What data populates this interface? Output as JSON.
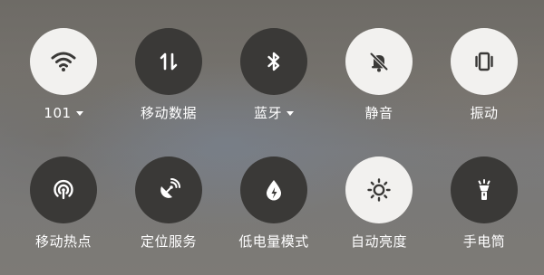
{
  "quick_settings": {
    "row1": [
      {
        "key": "wifi",
        "label": "101",
        "has_dropdown": true,
        "state": "on",
        "icon": "wifi-icon"
      },
      {
        "key": "mobile_data",
        "label": "移动数据",
        "has_dropdown": false,
        "state": "off",
        "icon": "data-transfer-icon"
      },
      {
        "key": "bluetooth",
        "label": "蓝牙",
        "has_dropdown": true,
        "state": "off",
        "icon": "bluetooth-icon"
      },
      {
        "key": "silent",
        "label": "静音",
        "has_dropdown": false,
        "state": "on",
        "icon": "bell-off-icon"
      },
      {
        "key": "vibrate",
        "label": "振动",
        "has_dropdown": false,
        "state": "on",
        "icon": "vibrate-icon"
      }
    ],
    "row2": [
      {
        "key": "hotspot",
        "label": "移动热点",
        "has_dropdown": false,
        "state": "off",
        "icon": "hotspot-icon"
      },
      {
        "key": "location",
        "label": "定位服务",
        "has_dropdown": false,
        "state": "off",
        "icon": "location-satellite-icon"
      },
      {
        "key": "battery_saver",
        "label": "低电量模式",
        "has_dropdown": false,
        "state": "off",
        "icon": "battery-saver-drop-icon"
      },
      {
        "key": "auto_brightness",
        "label": "自动亮度",
        "has_dropdown": false,
        "state": "on",
        "icon": "sun-icon"
      },
      {
        "key": "flashlight",
        "label": "手电筒",
        "has_dropdown": false,
        "state": "off",
        "icon": "flashlight-icon"
      }
    ]
  },
  "colors": {
    "tile_on_bg": "#f2f1ef",
    "tile_off_bg": "#3a3937",
    "icon_on": "#3a3937",
    "icon_off": "#ffffff",
    "label": "#ffffff"
  }
}
